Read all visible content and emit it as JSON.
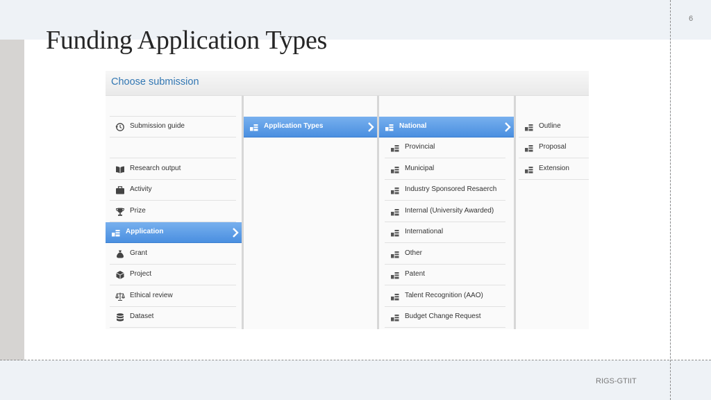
{
  "slide": {
    "title": "Funding Application Types",
    "page_number": "6",
    "footer": "RIGS-GTIIT"
  },
  "screenshot": {
    "header_title": "Choose submission",
    "accent_color": "#4a8fe0",
    "header_text_color": "#3277b3",
    "column1": [
      {
        "label": "",
        "icon": "blank"
      },
      {
        "label": "Submission guide",
        "icon": "clock-history-icon"
      },
      {
        "label": "",
        "icon": "blank"
      },
      {
        "label": "Research output",
        "icon": "book-icon"
      },
      {
        "label": "Activity",
        "icon": "briefcase-icon"
      },
      {
        "label": "Prize",
        "icon": "trophy-icon"
      },
      {
        "label": "Application",
        "icon": "stack-icon",
        "selected": true
      },
      {
        "label": "Grant",
        "icon": "money-bag-icon"
      },
      {
        "label": "Project",
        "icon": "cube-icon"
      },
      {
        "label": "Ethical review",
        "icon": "scales-icon"
      },
      {
        "label": "Dataset",
        "icon": "database-icon"
      }
    ],
    "column2": [
      {
        "label": "Application Types",
        "icon": "stack-icon",
        "selected": true
      }
    ],
    "column3": [
      {
        "label": "National",
        "icon": "stack-icon",
        "selected": true
      },
      {
        "label": "Provincial",
        "icon": "stack-icon"
      },
      {
        "label": "Municipal",
        "icon": "stack-icon"
      },
      {
        "label": "Industry Sponsored Resaerch",
        "icon": "stack-icon"
      },
      {
        "label": "Internal (University Awarded)",
        "icon": "stack-icon"
      },
      {
        "label": "International",
        "icon": "stack-icon"
      },
      {
        "label": "Other",
        "icon": "stack-icon"
      },
      {
        "label": "Patent",
        "icon": "stack-icon"
      },
      {
        "label": "Talent Recognition (AAO)",
        "icon": "stack-icon"
      },
      {
        "label": "Budget Change Request",
        "icon": "stack-icon"
      }
    ],
    "column4": [
      {
        "label": "Outline",
        "icon": "stack-icon"
      },
      {
        "label": "Proposal",
        "icon": "stack-icon"
      },
      {
        "label": "Extension",
        "icon": "stack-icon"
      }
    ]
  }
}
